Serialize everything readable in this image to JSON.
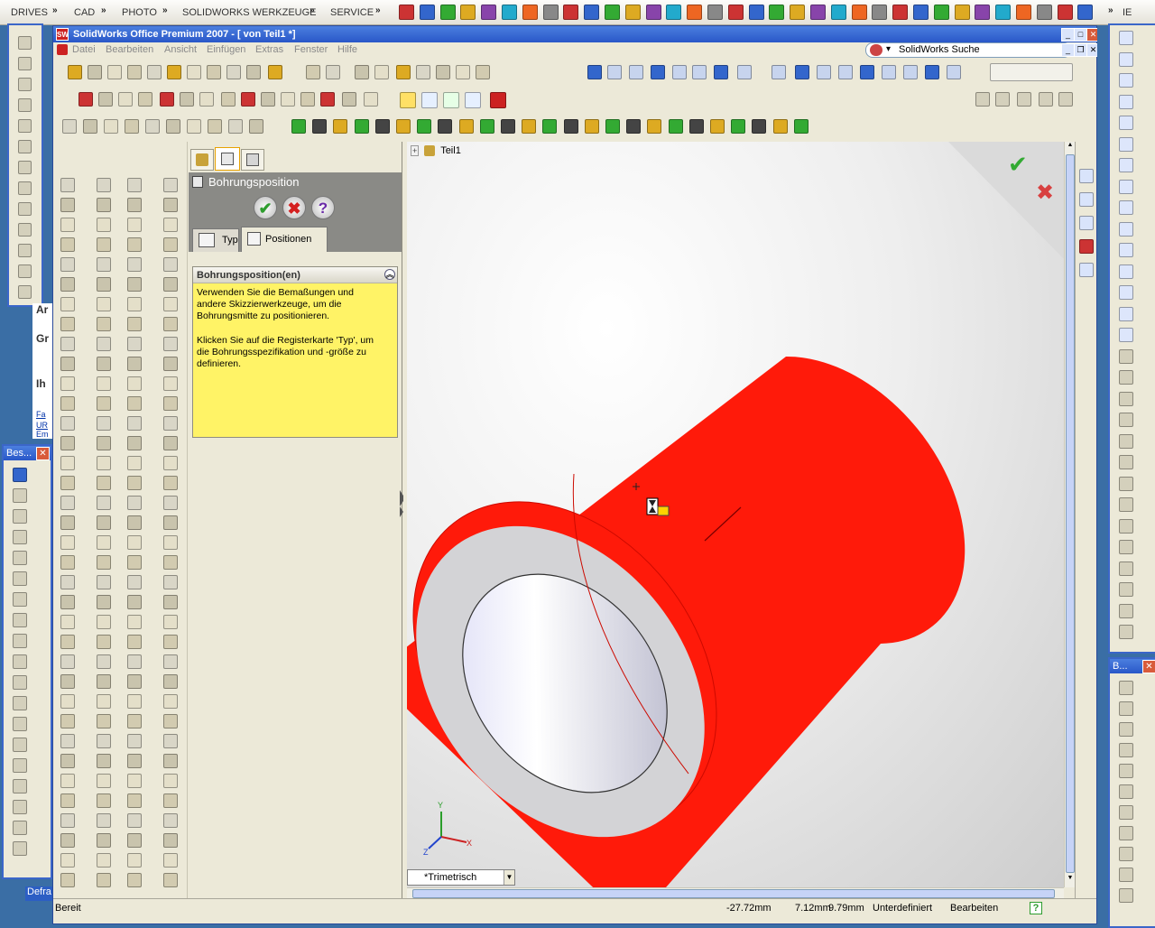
{
  "launcher": {
    "menus": [
      "DRIVES",
      "CAD",
      "PHOTO",
      "SOLIDWORKS WERKZEUGE",
      "SERVICE"
    ],
    "right_label": "IE"
  },
  "window": {
    "title": "SolidWorks Office Premium 2007 - [ von Teil1 *]",
    "menu": [
      "Datei",
      "Bearbeiten",
      "Ansicht",
      "Einfügen",
      "Extras",
      "Fenster",
      "Hilfe"
    ],
    "search_label": "SolidWorks Suche"
  },
  "left_panel": {
    "title": "Bes...",
    "bg_text": [
      "Ar",
      "Gr",
      "Ih",
      "Fa",
      "UR",
      "Em"
    ],
    "bottom_text": "Defra"
  },
  "right_panel": {
    "title": "B..."
  },
  "property_manager": {
    "title": "Bohrungsposition",
    "tab_typ": "Typ",
    "tab_positionen": "Positionen",
    "group_title": "Bohrungsposition(en)",
    "message_1": "Verwenden Sie die Bemaßungen und andere Skizzierwerkzeuge, um die Bohrungsmitte zu positionieren.",
    "message_2": "Klicken Sie auf die Registerkarte 'Typ', um die Bohrungsspezifikation und -größe zu definieren."
  },
  "viewport": {
    "tree_root": "Teil1",
    "view_orientation": "*Trimetrisch",
    "part_color": "#ff1a0a"
  },
  "statusbar": {
    "state": "Bereit",
    "x": "-27.72mm",
    "y": "7.12mm",
    "z": "9.79mm",
    "definition": "Unterdefiniert",
    "mode": "Bearbeiten"
  },
  "colors": {
    "titlebar": "#2f5fd0",
    "accent_green": "#2e9d2e",
    "accent_red": "#d42020",
    "tooltip_yellow": "#fff366"
  }
}
